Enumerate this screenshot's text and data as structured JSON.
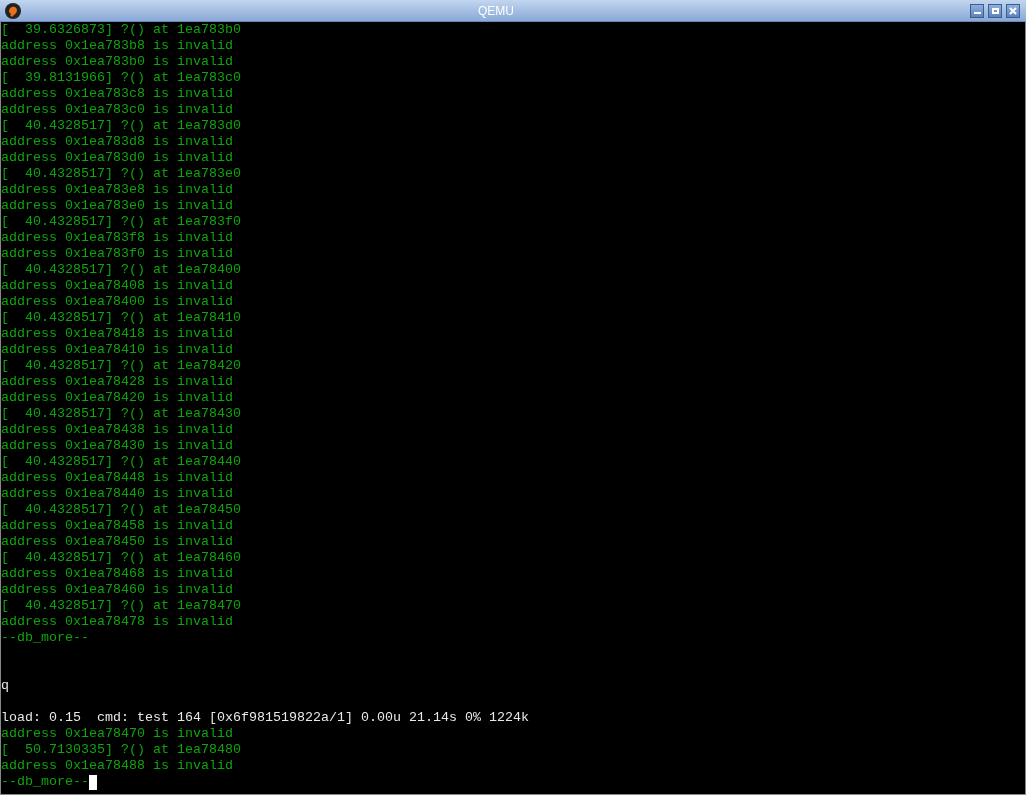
{
  "window": {
    "title": "QEMU"
  },
  "terminal": {
    "cursor": true,
    "lines": [
      {
        "kind": "kernel",
        "text": "[  39.6326873] ?() at 1ea783b0"
      },
      {
        "kind": "kernel",
        "text": "address 0x1ea783b8 is invalid"
      },
      {
        "kind": "kernel",
        "text": "address 0x1ea783b0 is invalid"
      },
      {
        "kind": "kernel",
        "text": "[  39.8131966] ?() at 1ea783c0"
      },
      {
        "kind": "kernel",
        "text": "address 0x1ea783c8 is invalid"
      },
      {
        "kind": "kernel",
        "text": "address 0x1ea783c0 is invalid"
      },
      {
        "kind": "kernel",
        "text": "[  40.4328517] ?() at 1ea783d0"
      },
      {
        "kind": "kernel",
        "text": "address 0x1ea783d8 is invalid"
      },
      {
        "kind": "kernel",
        "text": "address 0x1ea783d0 is invalid"
      },
      {
        "kind": "kernel",
        "text": "[  40.4328517] ?() at 1ea783e0"
      },
      {
        "kind": "kernel",
        "text": "address 0x1ea783e8 is invalid"
      },
      {
        "kind": "kernel",
        "text": "address 0x1ea783e0 is invalid"
      },
      {
        "kind": "kernel",
        "text": "[  40.4328517] ?() at 1ea783f0"
      },
      {
        "kind": "kernel",
        "text": "address 0x1ea783f8 is invalid"
      },
      {
        "kind": "kernel",
        "text": "address 0x1ea783f0 is invalid"
      },
      {
        "kind": "kernel",
        "text": "[  40.4328517] ?() at 1ea78400"
      },
      {
        "kind": "kernel",
        "text": "address 0x1ea78408 is invalid"
      },
      {
        "kind": "kernel",
        "text": "address 0x1ea78400 is invalid"
      },
      {
        "kind": "kernel",
        "text": "[  40.4328517] ?() at 1ea78410"
      },
      {
        "kind": "kernel",
        "text": "address 0x1ea78418 is invalid"
      },
      {
        "kind": "kernel",
        "text": "address 0x1ea78410 is invalid"
      },
      {
        "kind": "kernel",
        "text": "[  40.4328517] ?() at 1ea78420"
      },
      {
        "kind": "kernel",
        "text": "address 0x1ea78428 is invalid"
      },
      {
        "kind": "kernel",
        "text": "address 0x1ea78420 is invalid"
      },
      {
        "kind": "kernel",
        "text": "[  40.4328517] ?() at 1ea78430"
      },
      {
        "kind": "kernel",
        "text": "address 0x1ea78438 is invalid"
      },
      {
        "kind": "kernel",
        "text": "address 0x1ea78430 is invalid"
      },
      {
        "kind": "kernel",
        "text": "[  40.4328517] ?() at 1ea78440"
      },
      {
        "kind": "kernel",
        "text": "address 0x1ea78448 is invalid"
      },
      {
        "kind": "kernel",
        "text": "address 0x1ea78440 is invalid"
      },
      {
        "kind": "kernel",
        "text": "[  40.4328517] ?() at 1ea78450"
      },
      {
        "kind": "kernel",
        "text": "address 0x1ea78458 is invalid"
      },
      {
        "kind": "kernel",
        "text": "address 0x1ea78450 is invalid"
      },
      {
        "kind": "kernel",
        "text": "[  40.4328517] ?() at 1ea78460"
      },
      {
        "kind": "kernel",
        "text": "address 0x1ea78468 is invalid"
      },
      {
        "kind": "kernel",
        "text": "address 0x1ea78460 is invalid"
      },
      {
        "kind": "kernel",
        "text": "[  40.4328517] ?() at 1ea78470"
      },
      {
        "kind": "kernel",
        "text": "address 0x1ea78478 is invalid"
      },
      {
        "kind": "kernel",
        "text": "--db_more--"
      },
      {
        "kind": "blank"
      },
      {
        "kind": "blank"
      },
      {
        "kind": "user",
        "text": "q"
      },
      {
        "kind": "blank"
      },
      {
        "kind": "user",
        "text": "load: 0.15  cmd: test 164 [0x6f981519822a/1] 0.00u 21.14s 0% 1224k"
      },
      {
        "kind": "kernel",
        "text": "address 0x1ea78470 is invalid"
      },
      {
        "kind": "kernel",
        "text": "[  50.7130335] ?() at 1ea78480"
      },
      {
        "kind": "kernel",
        "text": "address 0x1ea78488 is invalid"
      },
      {
        "kind": "kernel",
        "text": "--db_more--"
      }
    ]
  }
}
